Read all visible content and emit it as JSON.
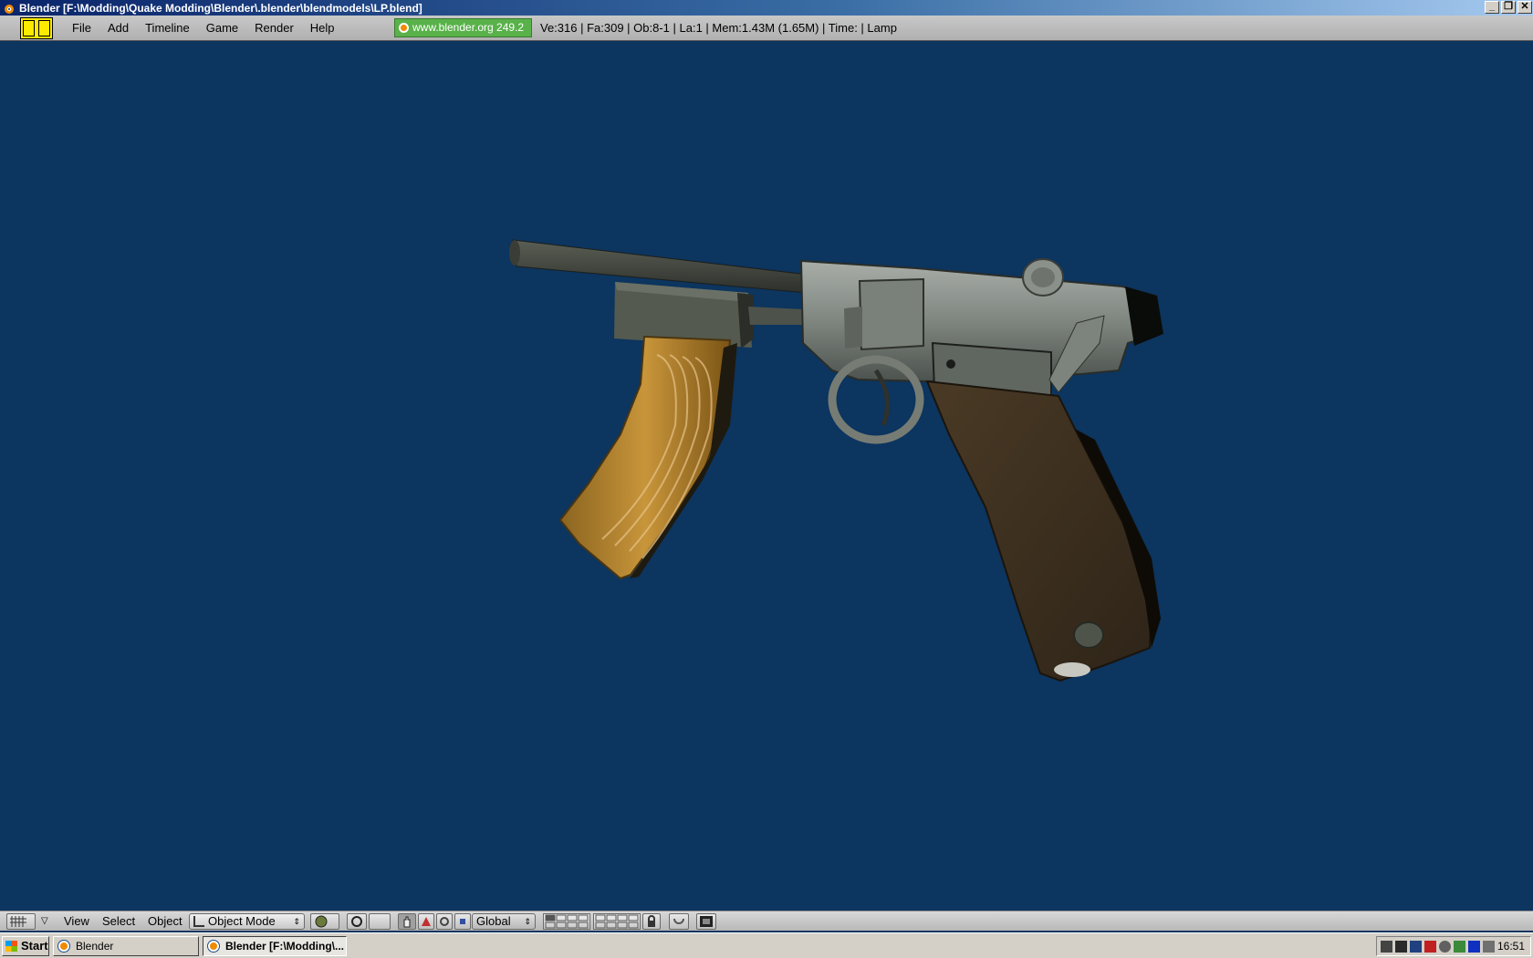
{
  "window": {
    "title": "Blender [F:\\Modding\\Quake Modding\\Blender\\.blender\\blendmodels\\LP.blend]",
    "minimize": "_",
    "restore": "❐",
    "close": "✕"
  },
  "menubar": {
    "items": [
      "File",
      "Add",
      "Timeline",
      "Game",
      "Render",
      "Help"
    ],
    "site_badge": "www.blender.org 249.2",
    "stats": "Ve:316 | Fa:309 | Ob:8-1 | La:1  | Mem:1.43M (1.65M)  | Time: | Lamp"
  },
  "view3d_header": {
    "menus": [
      "View",
      "Select",
      "Object"
    ],
    "mode": "Object Mode",
    "orientation": "Global"
  },
  "taskbar": {
    "start_label": "Start",
    "tasks": [
      "Blender",
      "Blender [F:\\Modding\\..."
    ],
    "clock": "16:51"
  },
  "colors": {
    "viewport_bg": "#0c355f",
    "badge_green": "#59b14a",
    "screen_icon": "#ffeb00"
  },
  "icons": [
    "blender-icon",
    "screen-layout-icon",
    "grid-view-icon",
    "mode-icon",
    "shading-icon",
    "pivot-icon",
    "manipulator-icon",
    "layer-grid-icon",
    "lock-icon",
    "render-icon",
    "windows-flag-icon",
    "tray-icons"
  ]
}
